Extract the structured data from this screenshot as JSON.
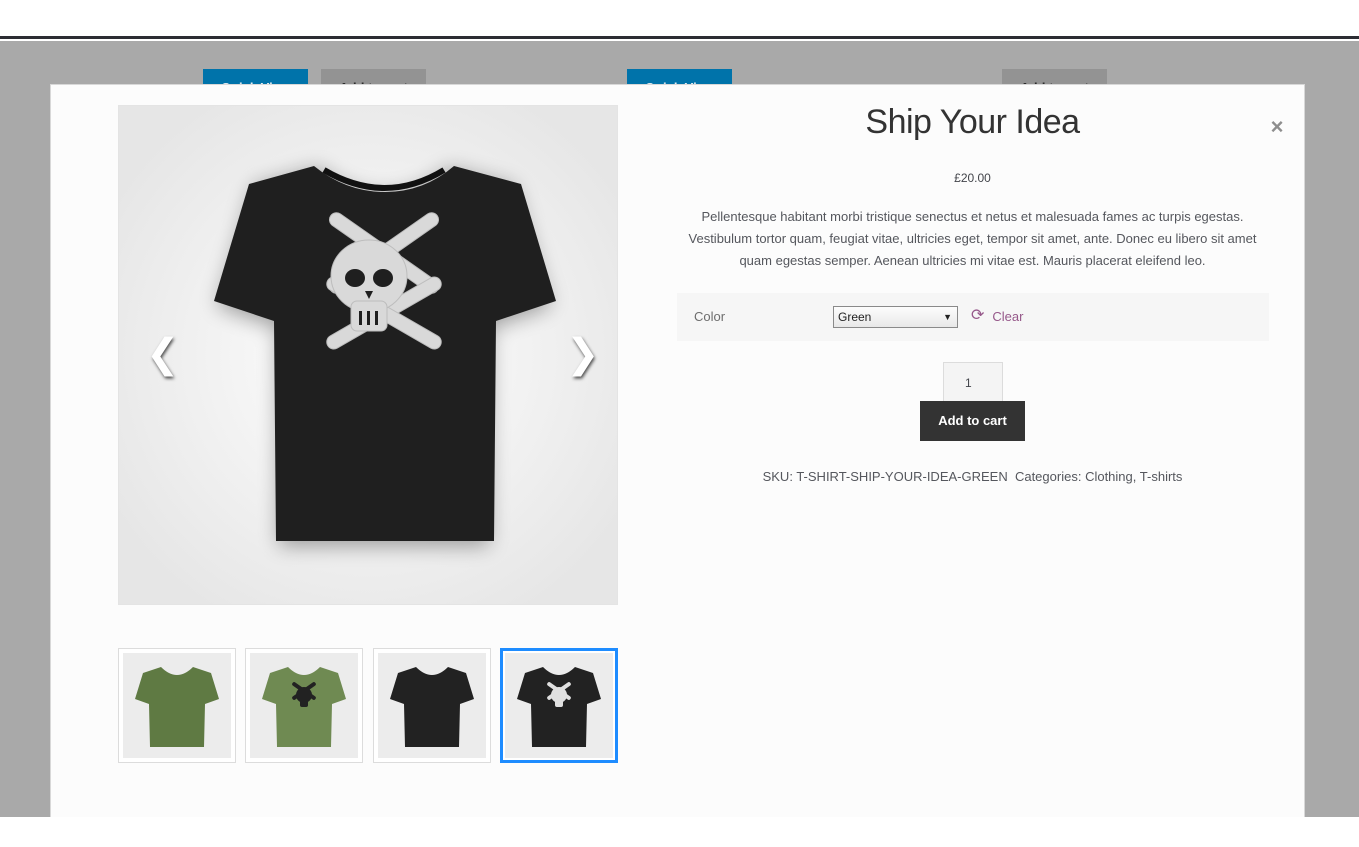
{
  "background": {
    "quick_view_label": "Quick View",
    "add_to_cart_label": "Add to cart"
  },
  "modal": {
    "close_glyph": "×",
    "title": "Ship Your Idea",
    "price": "£20.00",
    "description": "Pellentesque habitant morbi tristique senectus et netus et malesuada fames ac turpis egestas. Vestibulum tortor quam, feugiat vitae, ultricies eget, tempor sit amet, ante. Donec eu libero sit amet quam egestas semper. Aenean ultricies mi vitae est. Mauris placerat eleifend leo.",
    "gallery": {
      "prev_glyph": "❮",
      "next_glyph": "❯",
      "thumbnails": [
        {
          "shirt_color": "#5f7a43",
          "print": "none",
          "selected": false
        },
        {
          "shirt_color": "#6f8a52",
          "print": "skull",
          "selected": false
        },
        {
          "shirt_color": "#222222",
          "print": "none",
          "selected": false
        },
        {
          "shirt_color": "#222222",
          "print": "skull",
          "selected": true
        }
      ]
    },
    "variation": {
      "label": "Color",
      "selected": "Green",
      "clear_label": "Clear",
      "refresh_glyph": "⟳"
    },
    "quantity": "1",
    "add_to_cart": "Add to cart",
    "meta": {
      "sku_label": "SKU:",
      "sku": "T-SHIRT-SHIP-YOUR-IDEA-GREEN",
      "categories_label": "Categories:",
      "categories": [
        "Clothing",
        "T-shirts"
      ],
      "separator": ","
    }
  }
}
